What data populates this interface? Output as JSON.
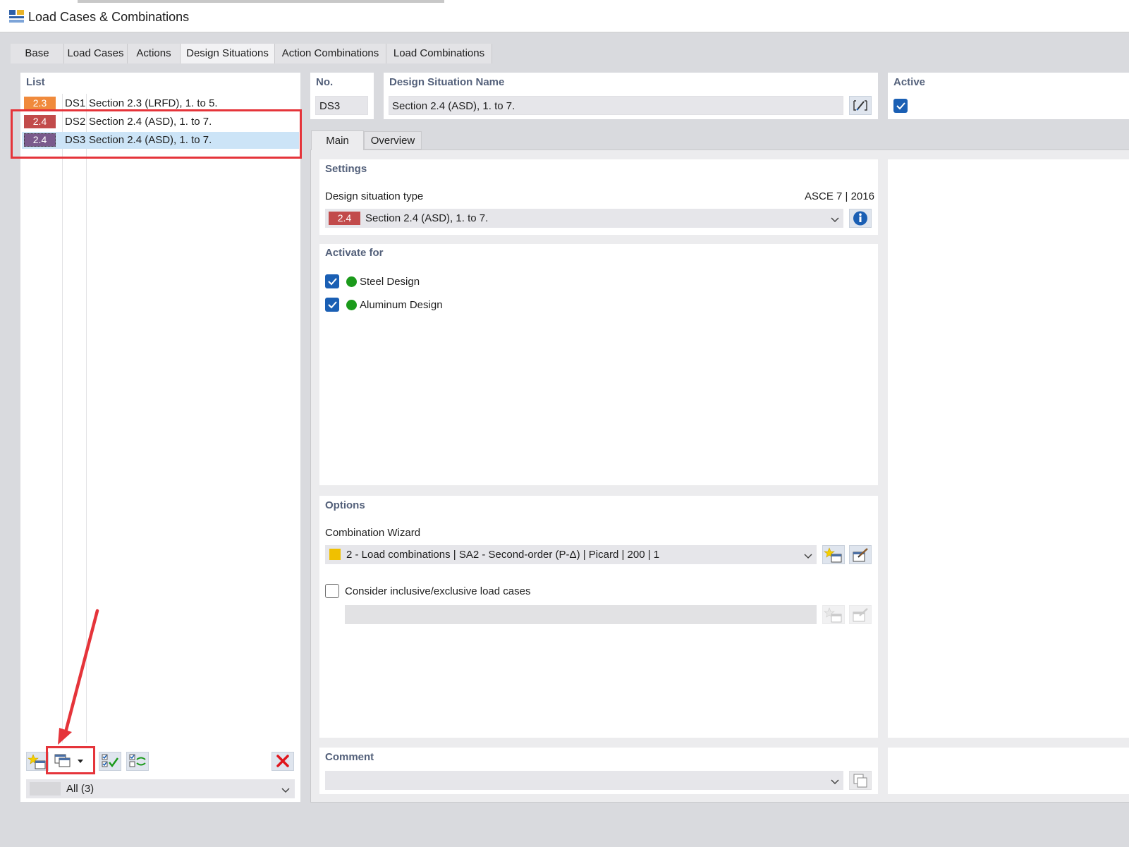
{
  "window": {
    "title": "Load Cases & Combinations"
  },
  "tabs": [
    "Base",
    "Load Cases",
    "Actions",
    "Design Situations",
    "Action Combinations",
    "Load Combinations"
  ],
  "list": {
    "header": "List",
    "items": [
      {
        "badge": "2.3",
        "badge_color": "#f08a3c",
        "id": "DS1",
        "name": "Section 2.3 (LRFD), 1. to 5."
      },
      {
        "badge": "2.4",
        "badge_color": "#c24b4b",
        "id": "DS2",
        "name": "Section 2.4 (ASD), 1. to 7."
      },
      {
        "badge": "2.4",
        "badge_color": "#7a5a8c",
        "id": "DS3",
        "name": "Section 2.4 (ASD), 1. to 7."
      }
    ],
    "filter": "All (3)"
  },
  "no": {
    "label": "No.",
    "value": "DS3"
  },
  "name": {
    "label": "Design Situation Name",
    "value": "Section 2.4 (ASD), 1. to 7."
  },
  "active": {
    "label": "Active",
    "checked": true
  },
  "subtabs": [
    "Main",
    "Overview"
  ],
  "settings": {
    "header": "Settings",
    "type_label": "Design situation type",
    "standard": "ASCE 7 | 2016",
    "type_badge": "2.4",
    "type_value": "Section 2.4 (ASD), 1. to 7."
  },
  "activate": {
    "header": "Activate for",
    "items": [
      "Steel Design",
      "Aluminum Design"
    ]
  },
  "options": {
    "header": "Options",
    "wizard_label": "Combination Wizard",
    "wizard_value": "2 - Load combinations | SA2 - Second-order (P-Δ) | Picard | 200 | 1",
    "inclusive_label": "Consider inclusive/exclusive load cases"
  },
  "comment": {
    "header": "Comment"
  },
  "colors": {
    "accent": "#1a5fb4",
    "header": "#53607a",
    "highlight": "#e5343a",
    "selected_row": "#cce4f7"
  }
}
